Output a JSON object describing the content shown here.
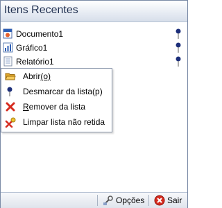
{
  "panel": {
    "title": "Itens Recentes"
  },
  "recent_items": [
    {
      "label": "Documento1",
      "icon": "document-icon"
    },
    {
      "label": "Gráfico1",
      "icon": "chart-icon"
    },
    {
      "label": "Relatório1",
      "icon": "report-icon"
    }
  ],
  "context_menu": {
    "items": [
      {
        "label_pre": "Abrir",
        "label_rest": "(o)",
        "icon": "folder-open-icon"
      },
      {
        "label": "Desmarcar da lista(p)",
        "icon": "pin-icon"
      },
      {
        "label_u": "R",
        "label_rest": "emover da lista",
        "icon": "remove-icon"
      },
      {
        "label": "Limpar lista não retida",
        "icon": "clear-list-icon"
      }
    ]
  },
  "footer": {
    "options_label": "Opções",
    "exit_label": "Sair"
  },
  "colors": {
    "accent": "#1f2f4f",
    "border": "#7a8aa6"
  }
}
